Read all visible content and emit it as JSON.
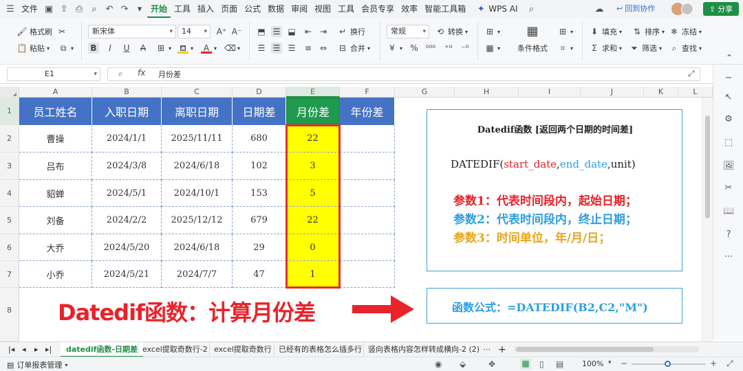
{
  "menubar": {
    "menu_label": "文件",
    "tabs": [
      "开始",
      "工具",
      "插入",
      "页面",
      "公式",
      "数据",
      "审阅",
      "视图",
      "工具",
      "会员专享",
      "效率",
      "智能工具箱"
    ],
    "wps_ai": "WPS AI",
    "back_label": "回到协作",
    "share_label": "分享"
  },
  "ribbon": {
    "format_painter": "格式刷",
    "paste": "粘贴",
    "font_name": "新宋体",
    "font_size": "14",
    "wrap": "换行",
    "merge": "合并",
    "number_format": "常规",
    "convert": "转换",
    "cond_format": "条件格式",
    "fill": "填充",
    "sort": "排序",
    "freeze": "冻结",
    "sum": "求和",
    "filter": "筛选",
    "find": "查找"
  },
  "formula_bar": {
    "name_box": "E1",
    "fx": "fx",
    "content": "月份差"
  },
  "columns": [
    "A",
    "B",
    "C",
    "D",
    "E",
    "F",
    "G",
    "H",
    "I",
    "J",
    "K",
    "L"
  ],
  "rows": [
    "1",
    "2",
    "3",
    "4",
    "5",
    "6",
    "7",
    "8"
  ],
  "table": {
    "headers": [
      "员工姓名",
      "入职日期",
      "离职日期",
      "日期差",
      "月份差",
      "年份差"
    ],
    "rows": [
      [
        "曹操",
        "2024/1/1",
        "2025/11/11",
        "680",
        "22",
        ""
      ],
      [
        "吕布",
        "2024/3/8",
        "2024/6/18",
        "102",
        "3",
        ""
      ],
      [
        "貂蝉",
        "2024/5/1",
        "2024/10/1",
        "153",
        "5",
        ""
      ],
      [
        "刘备",
        "2024/2/2",
        "2025/12/12",
        "679",
        "22",
        ""
      ],
      [
        "大乔",
        "2024/5/20",
        "2024/6/18",
        "29",
        "0",
        ""
      ],
      [
        "小乔",
        "2024/5/21",
        "2024/7/7",
        "47",
        "1",
        ""
      ]
    ]
  },
  "info_box": {
    "title": "Datedif函数 [返回两个日期的时间差]",
    "syntax_fn": "DATEDIF(",
    "syntax_start": "start_date",
    "syntax_comma1": ",",
    "syntax_end": "end_date",
    "syntax_rest": ",unit)",
    "param1": "参数1：代表时间段内，起始日期；",
    "param2": "参数2：代表时间段内，终止日期；",
    "param3": "参数3：时间单位，年/月/日；"
  },
  "formula_box": {
    "text": "函数公式：=DATEDIF(B2,C2,\"M\")"
  },
  "banner": "Datedif函数：计算月份差",
  "sheet_tabs": [
    "datedif函数-日期差",
    "excel提取奇数行-2",
    "excel提取奇数行",
    "已经有的表格怎么插多行",
    "竖向表格内容怎样转成横向-2 (2)"
  ],
  "status": {
    "left": "订单报表管理",
    "zoom": "100%"
  },
  "colors": {
    "accent": "#1f8f47",
    "header_blue": "#4472c4",
    "highlight_yellow": "#ffff00",
    "red": "#e8232a",
    "blue": "#2e9fe0",
    "orange": "#e8a51c"
  }
}
